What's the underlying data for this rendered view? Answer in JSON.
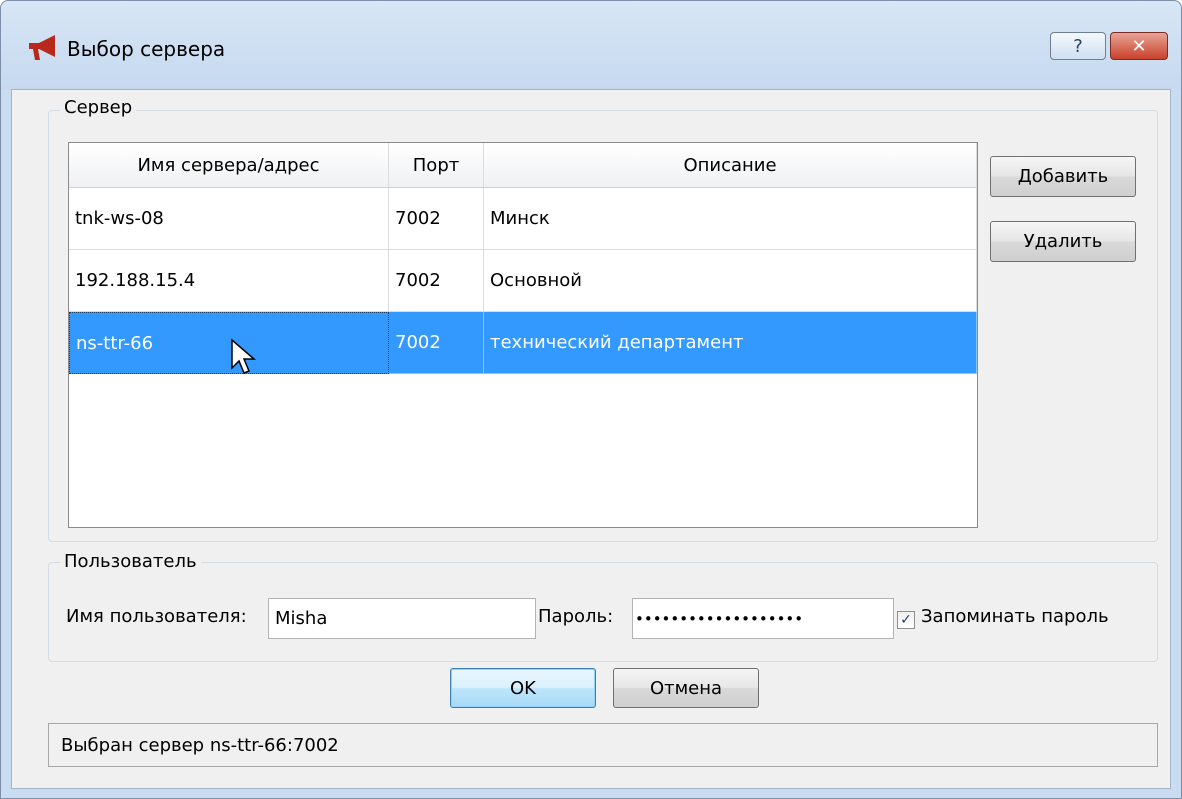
{
  "window": {
    "title": "Выбор сервера",
    "help_label": "?",
    "close_label": "✕",
    "app_icon": "megaphone-icon"
  },
  "server_group": {
    "title": "Сервер",
    "columns": [
      "Имя сервера/адрес",
      "Порт",
      "Описание"
    ],
    "rows": [
      {
        "name": "tnk-ws-08",
        "port": "7002",
        "description": "Минск"
      },
      {
        "name": "192.188.15.4",
        "port": "7002",
        "description": "Основной"
      },
      {
        "name": "ns-ttr-66",
        "port": "7002",
        "description": "технический департамент"
      }
    ],
    "selected_row": 2,
    "add_label": "Добавить",
    "delete_label": "Удалить"
  },
  "user_group": {
    "title": "Пользователь",
    "user_label": "Имя пользователя:",
    "user_value": "Misha",
    "password_label": "Пароль:",
    "password_value": "•••••••••••••••••••",
    "remember_checked": true,
    "remember_label": "Запоминать пароль"
  },
  "buttons": {
    "ok_label": "OK",
    "cancel_label": "Отмена"
  },
  "status": {
    "text": "Выбран сервер ns-ttr-66:7002"
  },
  "colors": {
    "selection": "#3399ff",
    "window_frame": "#c9dcf1",
    "close_button": "#c8412b"
  }
}
